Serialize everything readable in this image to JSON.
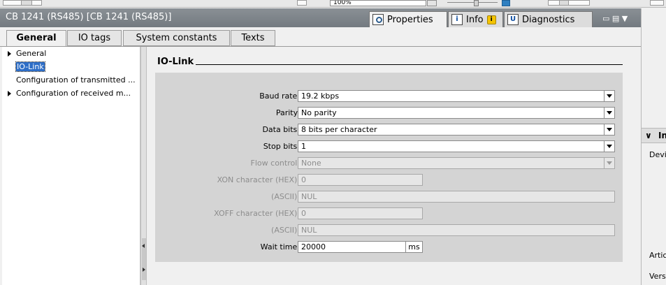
{
  "toolbar": {
    "zoom_value": "100%"
  },
  "titlebar": {
    "title": "CB 1241 (RS485) [CB 1241 (RS485)]",
    "tabs": [
      {
        "label": "Properties",
        "icon": "properties-icon"
      },
      {
        "label": "Info",
        "icon": "info-icon",
        "badge_icon": "warning-icon"
      },
      {
        "label": "Diagnostics",
        "icon": "diagnostics-icon"
      }
    ],
    "window_controls": "▭ ▤ ▼"
  },
  "main_tabs": [
    {
      "label": "General",
      "active": true
    },
    {
      "label": "IO tags",
      "active": false
    },
    {
      "label": "System constants",
      "active": false
    },
    {
      "label": "Texts",
      "active": false
    }
  ],
  "nav": [
    {
      "label": "General",
      "expandable": true,
      "selected": false
    },
    {
      "label": "IO-Link",
      "expandable": false,
      "selected": true
    },
    {
      "label": "Configuration of transmitted ...",
      "expandable": false,
      "selected": false
    },
    {
      "label": "Configuration of received m...",
      "expandable": true,
      "selected": false
    }
  ],
  "section": {
    "title": "IO-Link"
  },
  "form": {
    "baud_rate": {
      "label": "Baud rate:",
      "value": "19.2 kbps"
    },
    "parity": {
      "label": "Parity:",
      "value": "No parity"
    },
    "data_bits": {
      "label": "Data bits:",
      "value": "8 bits per character"
    },
    "stop_bits": {
      "label": "Stop bits:",
      "value": "1"
    },
    "flow_control": {
      "label": "Flow control:",
      "value": "None"
    },
    "xon_hex": {
      "label": "XON character (HEX):",
      "value": "0"
    },
    "xon_ascii": {
      "label": "(ASCII):",
      "value": "NUL"
    },
    "xoff_hex": {
      "label": "XOFF character (HEX):",
      "value": "0"
    },
    "xoff_ascii": {
      "label": "(ASCII):",
      "value": "NUL"
    },
    "wait_time": {
      "label": "Wait time:",
      "value": "20000",
      "unit": "ms"
    }
  },
  "right_panel": {
    "header": "In",
    "chevron": "∨",
    "line1": "Devi",
    "line2": "Artic",
    "line3": "Vers"
  },
  "colors": {
    "titlebar": "#7d8489",
    "selection": "#2e6ec7",
    "group_bg": "#d4d4d4"
  }
}
